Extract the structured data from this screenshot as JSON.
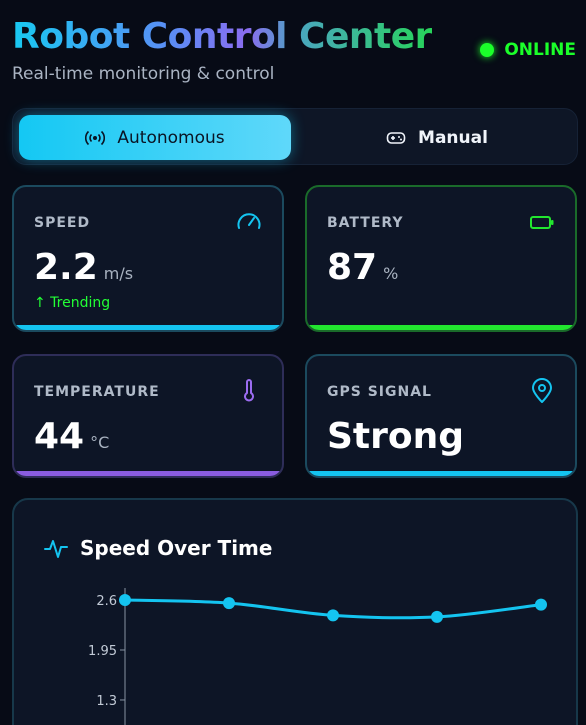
{
  "header": {
    "title": "Robot Control Center",
    "subtitle": "Real-time monitoring & control",
    "status": "ONLINE",
    "status_color": "#1bff2a"
  },
  "mode_toggle": {
    "options": [
      {
        "label": "Autonomous",
        "icon": "broadcast-icon",
        "active": true
      },
      {
        "label": "Manual",
        "icon": "gamepad-icon",
        "active": false
      }
    ]
  },
  "cards": {
    "speed": {
      "label": "SPEED",
      "value": "2.2",
      "unit": "m/s",
      "trend": "↑ Trending",
      "icon": "gauge-icon",
      "accent": "#14c4f0"
    },
    "battery": {
      "label": "BATTERY",
      "value": "87",
      "unit": "%",
      "icon": "battery-icon",
      "accent": "#22e62f"
    },
    "temperature": {
      "label": "TEMPERATURE",
      "value": "44",
      "unit": "°C",
      "icon": "thermometer-icon",
      "accent": "#8a5ce0"
    },
    "gps": {
      "label": "GPS SIGNAL",
      "value": "Strong",
      "icon": "map-pin-icon",
      "accent": "#14c4f0"
    }
  },
  "chart_panel": {
    "title": "Speed Over Time",
    "icon": "activity-icon"
  },
  "chart_data": {
    "type": "line",
    "title": "Speed Over Time",
    "y_ticks": [
      "2.6",
      "1.95",
      "1.3"
    ],
    "ylim": [
      0,
      2.6
    ],
    "values": [
      2.6,
      2.56,
      2.4,
      2.38,
      2.54
    ],
    "color": "#14c4f0",
    "grid": false
  }
}
